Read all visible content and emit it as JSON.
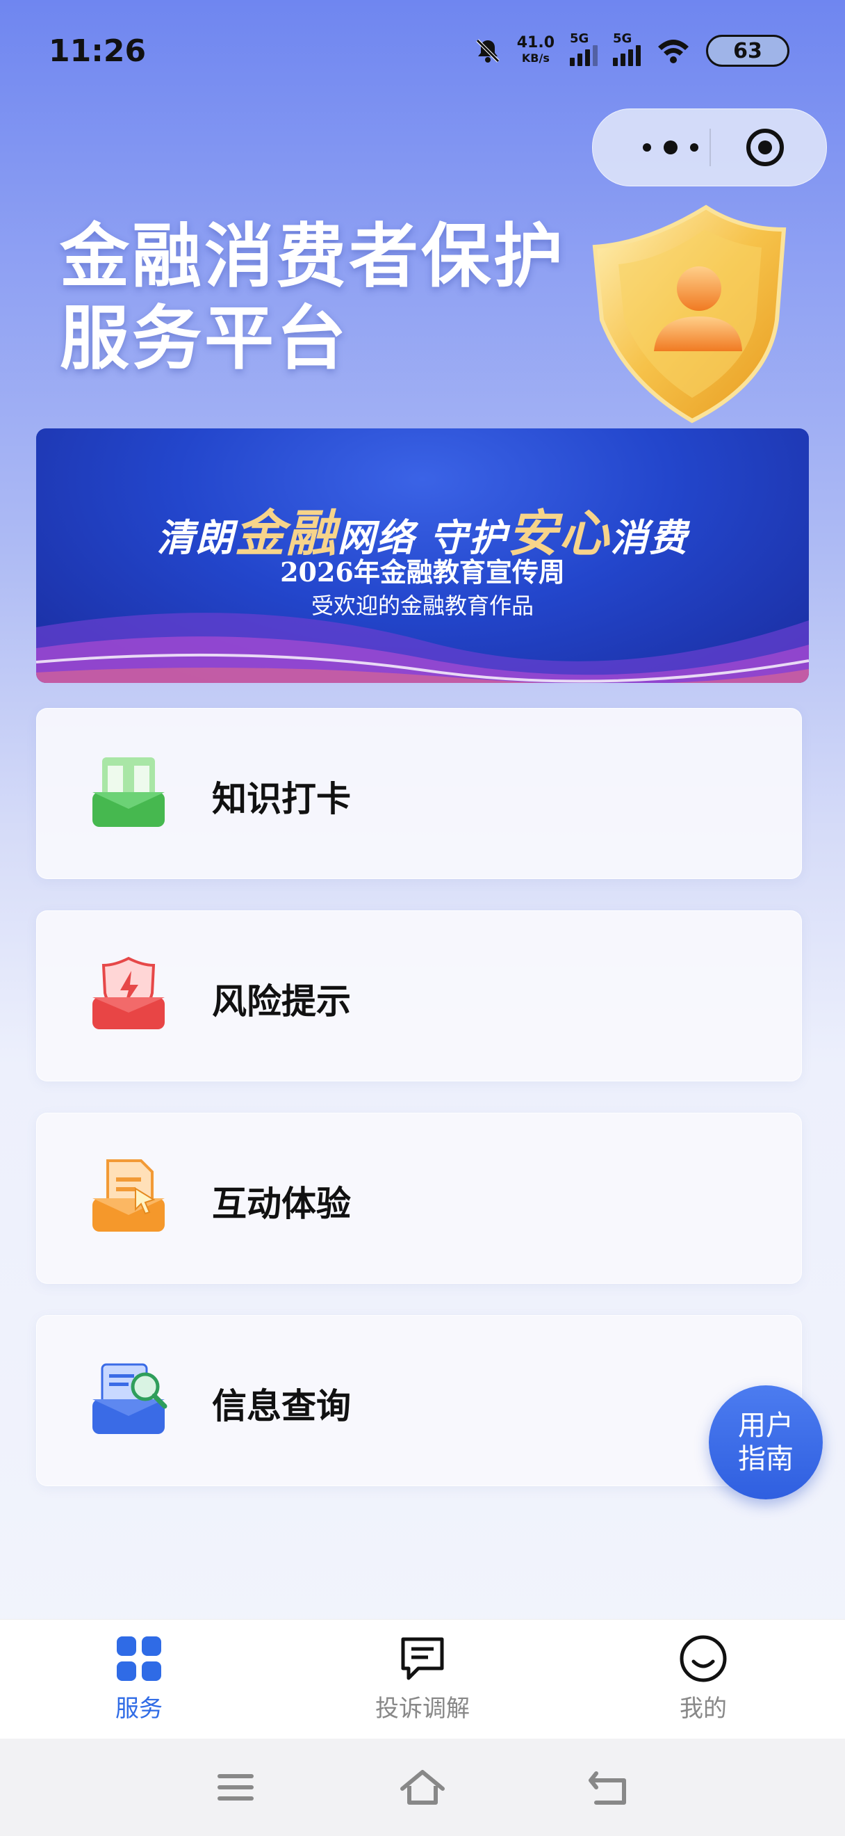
{
  "status_bar": {
    "time": "11:26",
    "net_speed_value": "41.0",
    "net_speed_unit": "KB/s",
    "sim1_label": "5G",
    "sim2_label": "5G",
    "battery": "63",
    "icons": [
      "bell-muted-icon",
      "signal-icon",
      "signal-icon",
      "wifi-icon",
      "battery-icon"
    ]
  },
  "capsule": {
    "icons": [
      "more-dots-icon",
      "target-close-icon"
    ]
  },
  "hero": {
    "title_line1": "金融消费者保护",
    "title_line2": "服务平台",
    "emblem": "shield-user-icon"
  },
  "banner": {
    "slogan_part1": "清朗",
    "slogan_gold1": "金融",
    "slogan_part2": "网络  守护",
    "slogan_gold2": "安心",
    "slogan_part3": "消费",
    "year_line": "2026年金融教育宣传周",
    "sub_line": "受欢迎的金融教育作品"
  },
  "menu": {
    "items": [
      {
        "label": "知识打卡",
        "icon": "open-book-icon",
        "color": "#4cc35a"
      },
      {
        "label": "风险提示",
        "icon": "risk-shield-icon",
        "color": "#ea4a4a"
      },
      {
        "label": "互动体验",
        "icon": "document-pointer-icon",
        "color": "#f39a2e"
      },
      {
        "label": "信息查询",
        "icon": "search-document-icon",
        "color": "#3a6be6"
      }
    ]
  },
  "floating_button": {
    "line1": "用户",
    "line2": "指南"
  },
  "tabbar": {
    "tabs": [
      {
        "label": "服务",
        "icon": "grid-icon",
        "active": true
      },
      {
        "label": "投诉调解",
        "icon": "message-icon",
        "active": false
      },
      {
        "label": "我的",
        "icon": "smile-icon",
        "active": false
      }
    ],
    "active_color": "#2f6be6"
  },
  "system_nav": {
    "icons": [
      "menu-icon",
      "home-icon",
      "back-icon"
    ]
  }
}
